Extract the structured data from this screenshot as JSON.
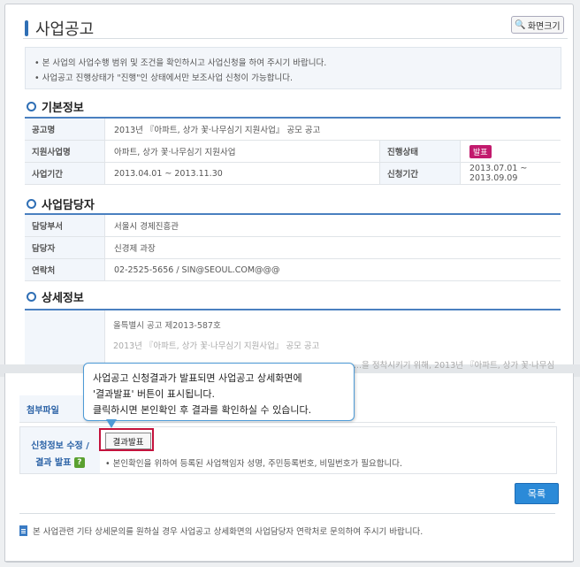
{
  "page": {
    "title": "사업공고",
    "zoom_label": "화면크기",
    "notices": [
      "본 사업의 사업수행 범위 및 조건을 확인하시고 사업신청을 하여 주시기 바랍니다.",
      "사업공고 진행상태가 \"진행\"인 상태에서만 보조사업 신청이 가능합니다."
    ]
  },
  "basic": {
    "section_title": "기본정보",
    "notice_name_label": "공고명",
    "notice_name": "2013년 『아파트, 상가 꽃·나무심기 지원사업』 공모 공고",
    "project_label": "지원사업명",
    "project": "아파트, 상가 꽃·나무심기 지원사업",
    "status_label": "진행상태",
    "status": "발표",
    "period_label": "사업기간",
    "period": "2013.04.01 ~ 2013.11.30",
    "apply_period_label": "신청기간",
    "apply_period": "2013.07.01 ~ 2013.09.09"
  },
  "contact": {
    "section_title": "사업담당자",
    "dept_label": "담당부서",
    "dept": "서울시 경제진흥관",
    "person_label": "담당자",
    "person": "신경제 과장",
    "phone_label": "연락처",
    "phone": "02-2525-5656 / SIN@SEOUL.COM@@@"
  },
  "detail": {
    "section_title": "상세정보",
    "line1": "올특별시 공고 제2013-587호",
    "line2": "2013년 『아파트, 상가 꽃·나무심기 지원사업』 공모 공고",
    "line3": "...을 정착시키기 위해, 2013년 『아파트, 상가 꽃·나무심"
  },
  "attach": {
    "label": "첨부파일"
  },
  "apply": {
    "label_line1": "신청정보 수정 /",
    "label_line2": "결과 발표",
    "help_icon": "?",
    "result_button": "결과발표",
    "note": "본인확인을 위하여 등록된 사업책임자 성명, 주민등록번호, 비밀번호가 필요합니다."
  },
  "list_button": "목록",
  "footer_note": "본 사업관련 기타 상세문의를 원하실 경우 사업공고 상세화면의 사업담당자 연락처로 문의하여 주시기 바랍니다.",
  "tooltip": {
    "line1": "사업공고 신청결과가 발표되면 사업공고 상세화면에",
    "line2": "'결과발표' 버튼이 표시됩니다.",
    "line3": "클릭하시면 본인확인 후 결과를 확인하실 수 있습니다."
  }
}
